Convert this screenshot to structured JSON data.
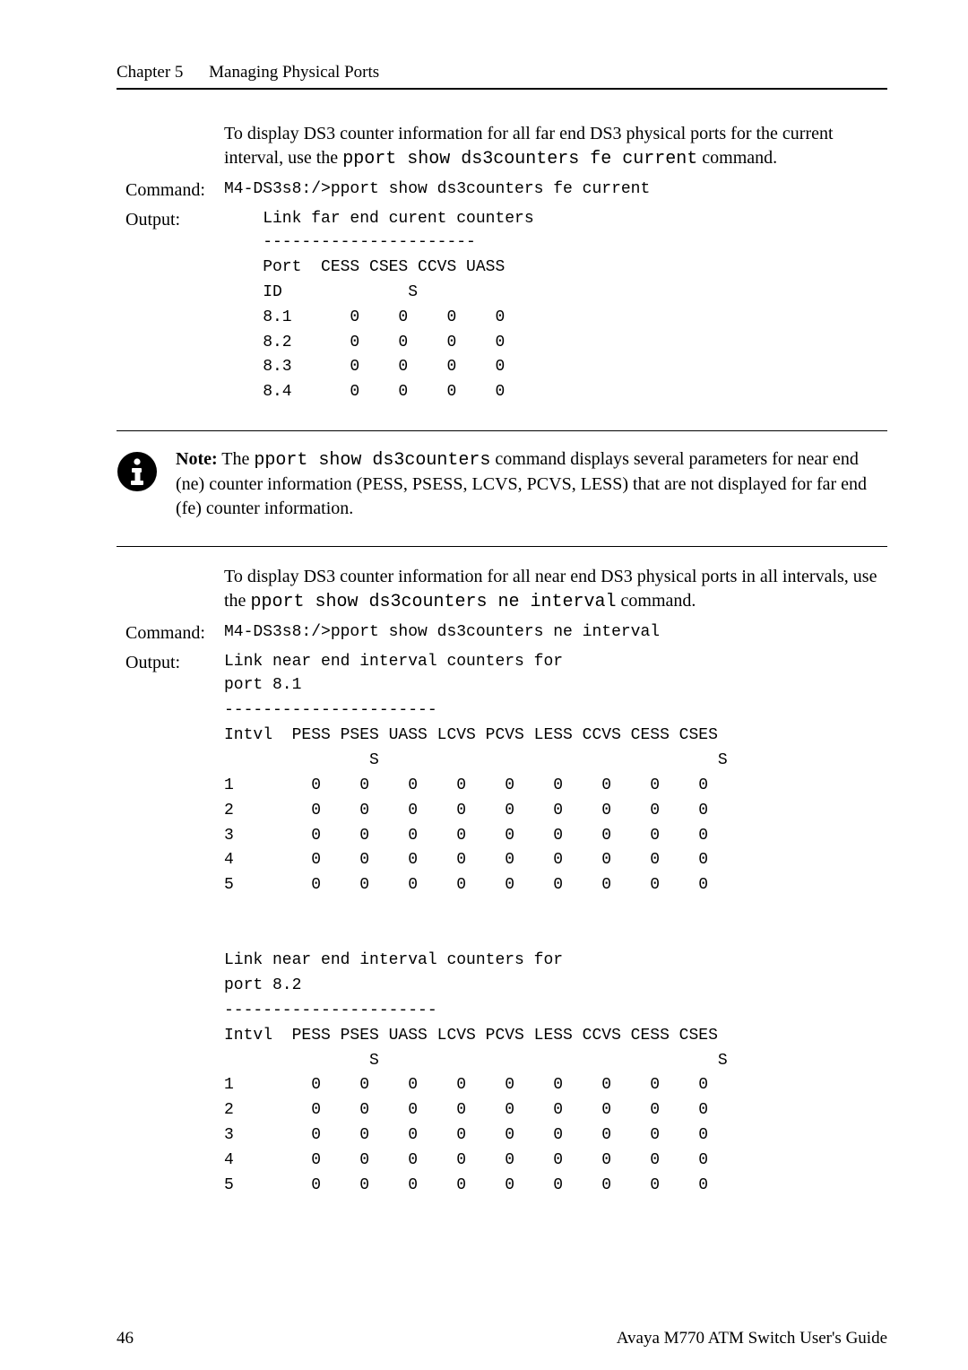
{
  "runningHead": {
    "chapter": "Chapter 5",
    "title": "Managing Physical Ports"
  },
  "para1_a": "To display DS3 counter information for all far end DS3 physical ports for the current interval, use the ",
  "para1_code": "pport show ds3counters fe current",
  "para1_b": " command.",
  "block1": {
    "commandLabel": "Command:",
    "command": "M4-DS3s8:/>pport show ds3counters fe current",
    "outputLabel": "Output:",
    "outputFirstLine": "    Link far end curent counters",
    "outputRest": "    ----------------------\n    Port  CESS CSES CCVS UASS\n    ID             S\n    8.1      0    0    0    0\n    8.2      0    0    0    0\n    8.3      0    0    0    0\n    8.4      0    0    0    0"
  },
  "note": {
    "bold": "Note:",
    "a": " The ",
    "code": "pport show ds3counters",
    "b": " command displays several parameters for near end (ne) counter information (PESS, PSESS, LCVS, PCVS, LESS) that are not displayed for far end (fe) counter information."
  },
  "para2_a": "To display DS3 counter information for all near end DS3 physical ports in all intervals, use the ",
  "para2_code": "pport show ds3counters ne interval",
  "para2_b": " command.",
  "block2": {
    "commandLabel": "Command:",
    "command": "M4-DS3s8:/>pport show ds3counters ne interval",
    "outputLabel": "Output:",
    "outputFirstLine": "Link near end interval counters for",
    "outputRest": "port 8.1\n----------------------\nIntvl  PESS PSES UASS LCVS PCVS LESS CCVS CESS CSES\n               S                                   S\n1        0    0    0    0    0    0    0    0    0\n2        0    0    0    0    0    0    0    0    0\n3        0    0    0    0    0    0    0    0    0\n4        0    0    0    0    0    0    0    0    0\n5        0    0    0    0    0    0    0    0    0\n\n\nLink near end interval counters for\nport 8.2\n----------------------\nIntvl  PESS PSES UASS LCVS PCVS LESS CCVS CESS CSES\n               S                                   S\n1        0    0    0    0    0    0    0    0    0\n2        0    0    0    0    0    0    0    0    0\n3        0    0    0    0    0    0    0    0    0\n4        0    0    0    0    0    0    0    0    0\n5        0    0    0    0    0    0    0    0    0"
  },
  "footer": {
    "pageNum": "46",
    "bookTitle": "Avaya M770 ATM Switch User's Guide"
  }
}
